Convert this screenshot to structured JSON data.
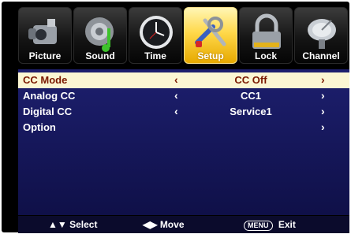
{
  "tabs": [
    {
      "label": "Picture",
      "icon": "camcorder-icon"
    },
    {
      "label": "Sound",
      "icon": "speaker-note-icon"
    },
    {
      "label": "Time",
      "icon": "clock-icon"
    },
    {
      "label": "Setup",
      "icon": "tools-icon",
      "active": true
    },
    {
      "label": "Lock",
      "icon": "lock-icon"
    },
    {
      "label": "Channel",
      "icon": "satellite-dish-icon"
    }
  ],
  "menu": {
    "rows": [
      {
        "name": "CC Mode",
        "value": "CC Off",
        "selected": true
      },
      {
        "name": "Analog CC",
        "value": "CC1"
      },
      {
        "name": "Digital CC",
        "value": "Service1"
      },
      {
        "name": "Option",
        "value": ""
      }
    ]
  },
  "help": {
    "select_label": "Select",
    "move_label": "Move",
    "menu_key": "MENU",
    "exit_label": "Exit"
  },
  "colors": {
    "panel_bg": "#1d1f6e",
    "selected_row_bg": "#fbf6d3",
    "selected_row_text": "#7a1800",
    "active_tab": "#ffd84a"
  }
}
